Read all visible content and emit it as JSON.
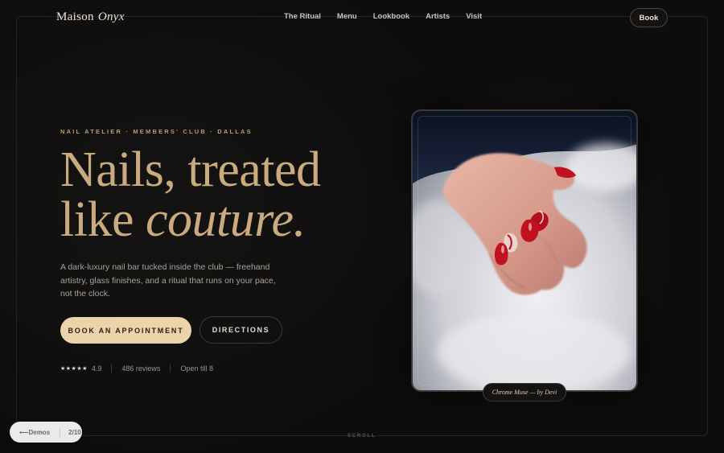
{
  "brand": {
    "name": "Maison",
    "accent": "Onyx"
  },
  "nav": {
    "items": [
      "The Ritual",
      "Menu",
      "Lookbook",
      "Artists",
      "Visit"
    ],
    "book_label": "Book"
  },
  "hero": {
    "eyebrow": "NAIL ATELIER · MEMBERS' CLUB · DALLAS",
    "headline_line1": "Nails, treated",
    "headline_line2_plain": "like ",
    "headline_line2_italic": "couture.",
    "lede": "A dark-luxury nail bar tucked inside the club — freehand artistry, glass finishes, and a ritual that runs on your pace, not the clock.",
    "cta_primary": "BOOK AN APPOINTMENT",
    "cta_secondary": "DIRECTIONS"
  },
  "meta": {
    "stars": "★★★★★",
    "rating": "4.9",
    "reviews": "486 reviews",
    "hours": "Open till 8"
  },
  "photo": {
    "caption": "Chrome Muse — by Devi",
    "description_icon": "hand-nails-photo"
  },
  "scroll_hint": "SCROLL",
  "demo_nav": {
    "back_label": "Demos",
    "counter": "2/10"
  },
  "colors": {
    "background": "#0e0d0d",
    "gold": "#c9ab7f",
    "cta": "#ecd3aa",
    "nail_red": "#c1121f"
  }
}
